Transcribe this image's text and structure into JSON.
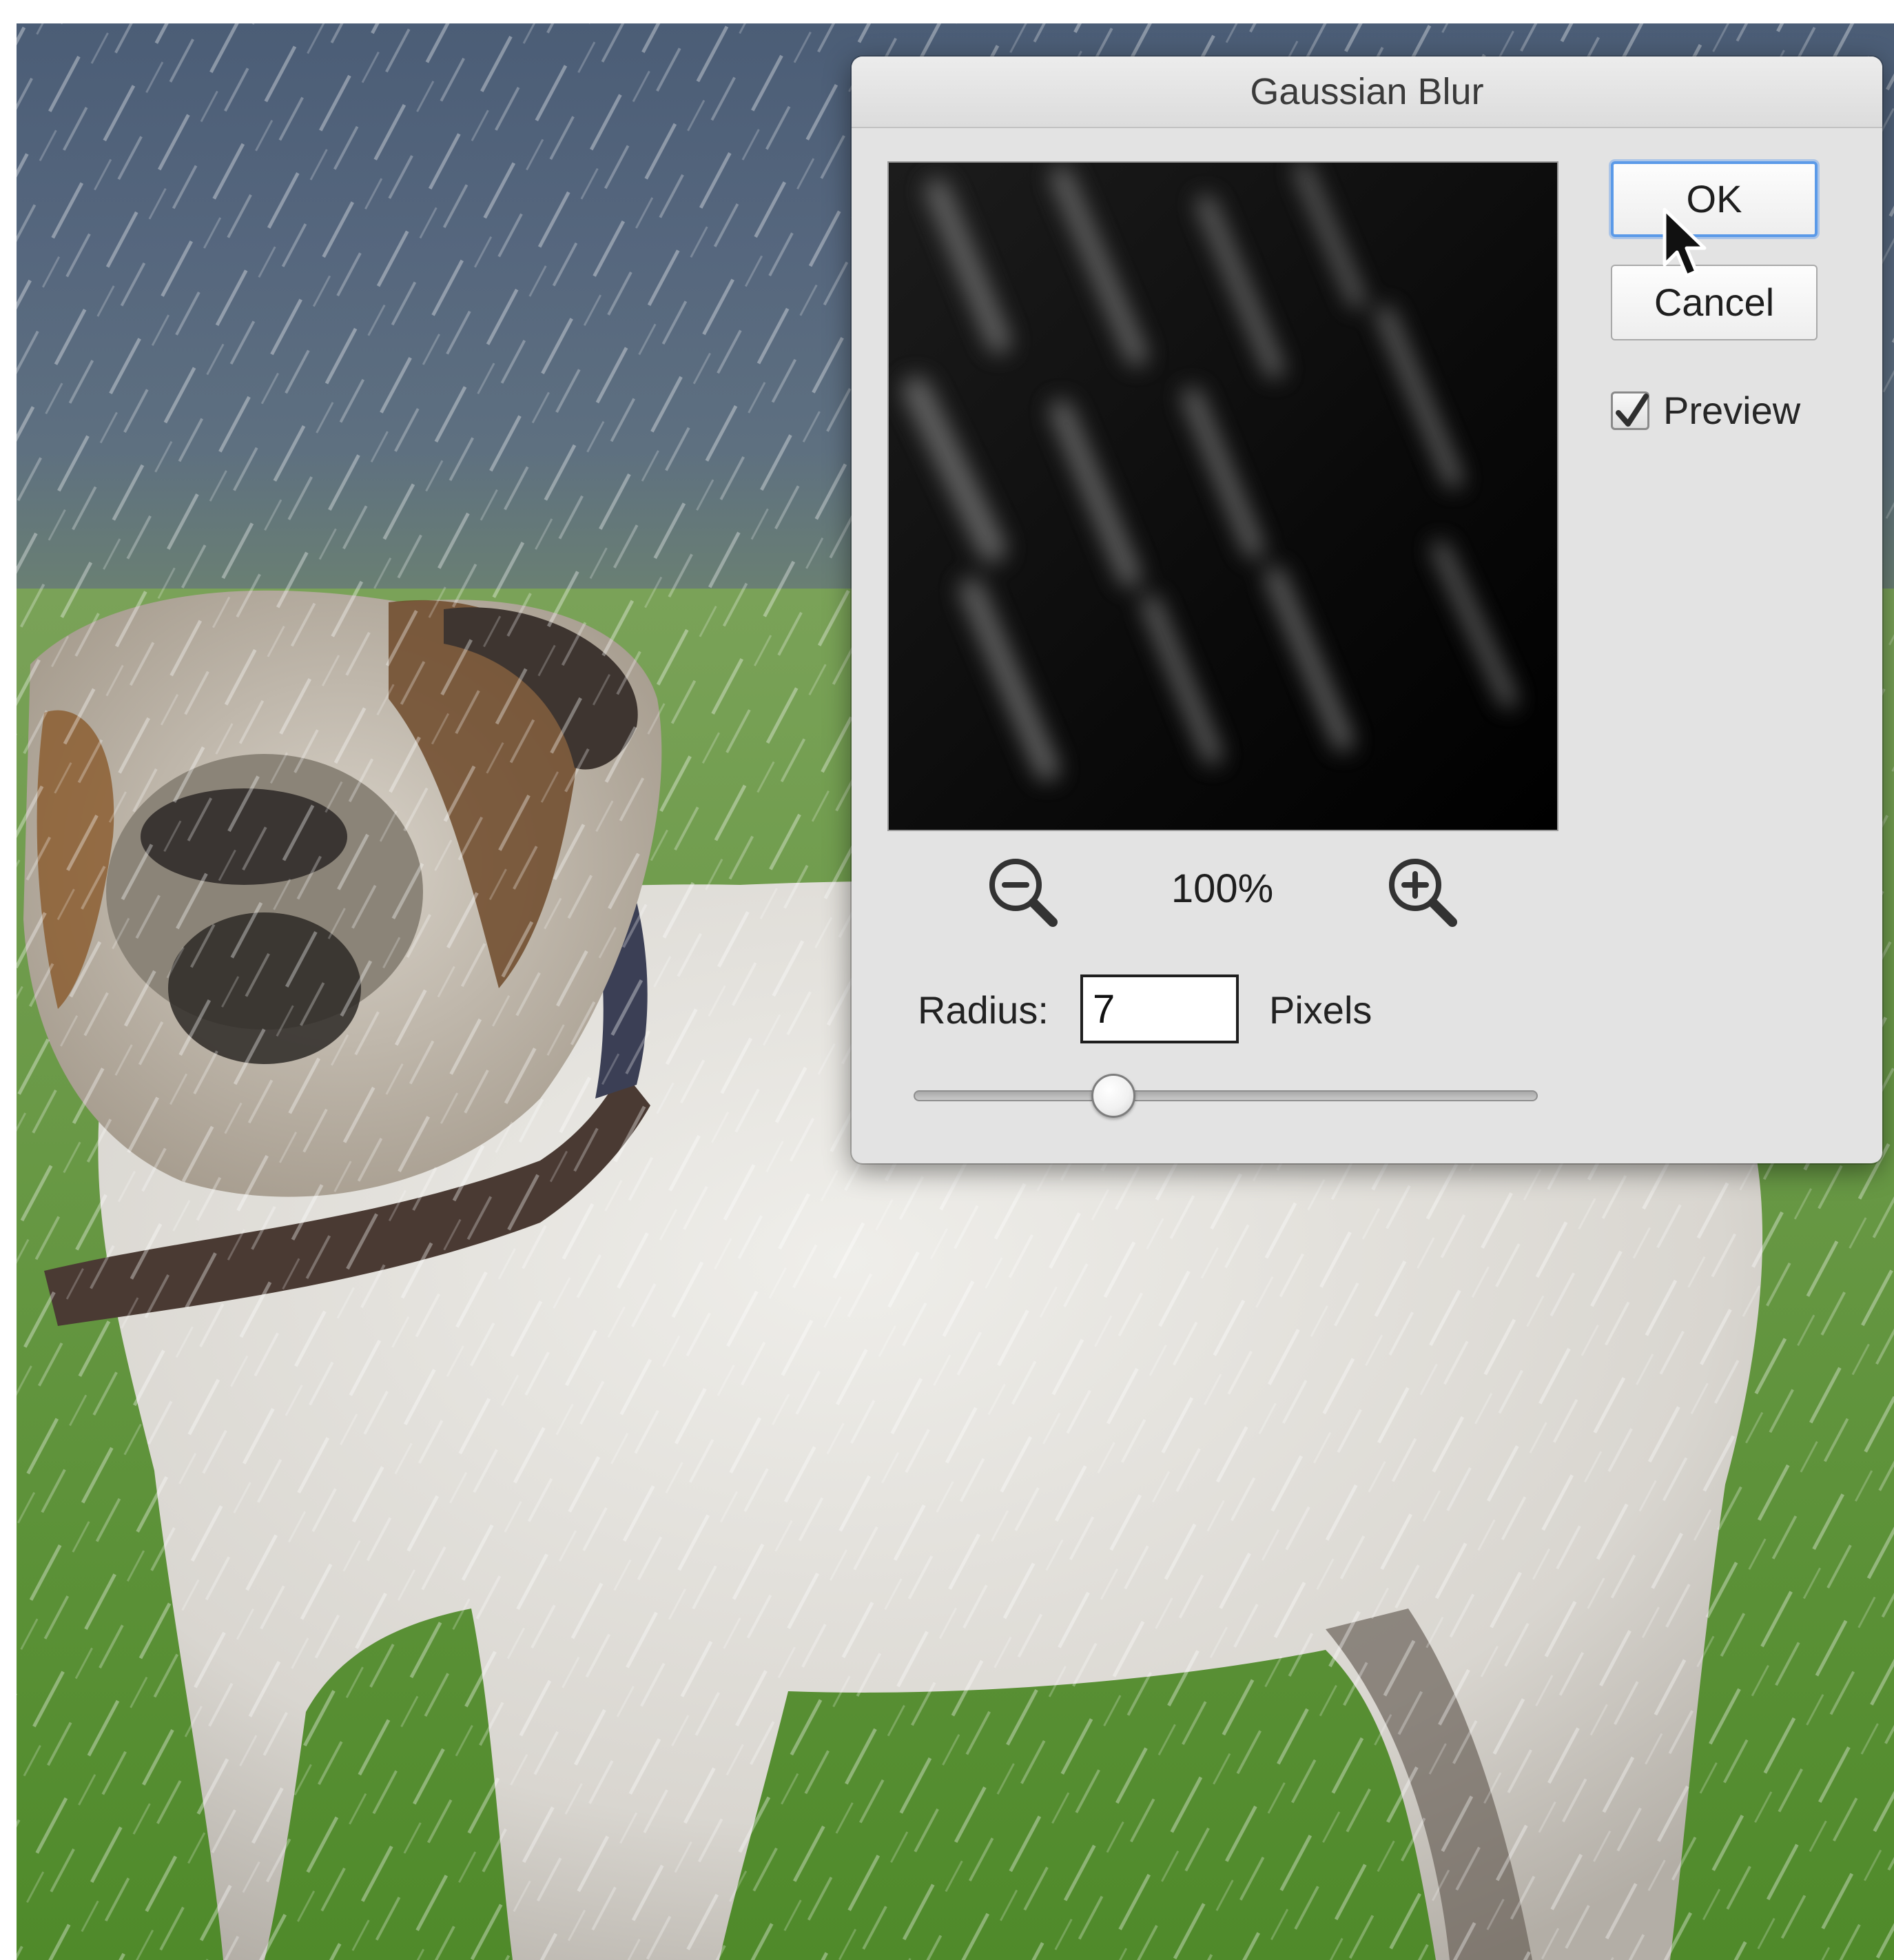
{
  "dialog": {
    "title": "Gaussian Blur",
    "ok_label": "OK",
    "cancel_label": "Cancel",
    "preview_label": "Preview",
    "preview_checked": true,
    "zoom_level": "100%",
    "radius_label": "Radius:",
    "radius_value": "7",
    "units_label": "Pixels",
    "slider_level": 0.32
  },
  "icons": {
    "zoom_out": "zoom-out-icon",
    "zoom_in": "zoom-in-icon",
    "check": "checkmark-icon",
    "cursor": "mouse-cursor-icon"
  },
  "colors": {
    "dialog_bg": "#e3e3e3",
    "ok_focus_ring": "#5b9ae8",
    "preview_bg": "#050505"
  }
}
